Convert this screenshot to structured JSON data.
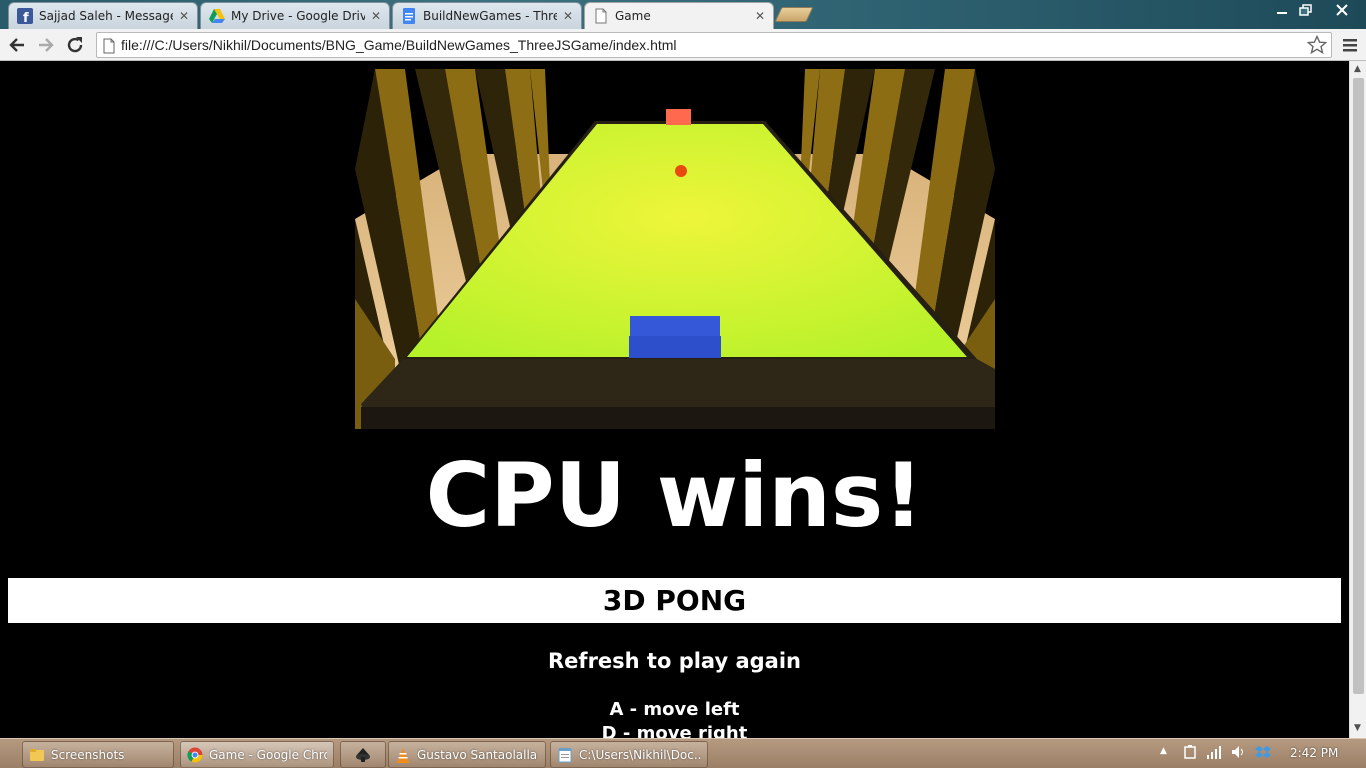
{
  "browser": {
    "tabs": [
      {
        "title": "Sajjad Saleh - Messages",
        "icon": "facebook-icon"
      },
      {
        "title": "My Drive - Google Drive",
        "icon": "google-drive-icon"
      },
      {
        "title": "BuildNewGames - Three.J",
        "icon": "google-docs-icon"
      },
      {
        "title": "Game",
        "icon": "page-icon"
      }
    ],
    "url": "file:///C:/Users/Nikhil/Documents/BNG_Game/BuildNewGames_ThreeJSGame/index.html"
  },
  "page": {
    "winner_text": "CPU wins!",
    "game_title": "3D PONG",
    "refresh_text": "Refresh to play again",
    "controls": [
      "A - move left",
      "D - move right"
    ]
  },
  "colors": {
    "table": "#c4f531",
    "player_paddle": "#3558d8",
    "cpu_paddle": "#ff6a4f",
    "ball": "#e84a10"
  },
  "taskbar": {
    "items": [
      {
        "label": "Screenshots",
        "icon": "folder-icon"
      },
      {
        "label": "Game - Google Chro...",
        "icon": "chrome-icon"
      },
      {
        "label": "",
        "icon": "inkscape-icon"
      },
      {
        "label": "Gustavo Santaolalla -...",
        "icon": "vlc-icon"
      },
      {
        "label": "C:\\Users\\Nikhil\\Doc...",
        "icon": "notepad-icon"
      }
    ],
    "clock": "2:42 PM"
  }
}
